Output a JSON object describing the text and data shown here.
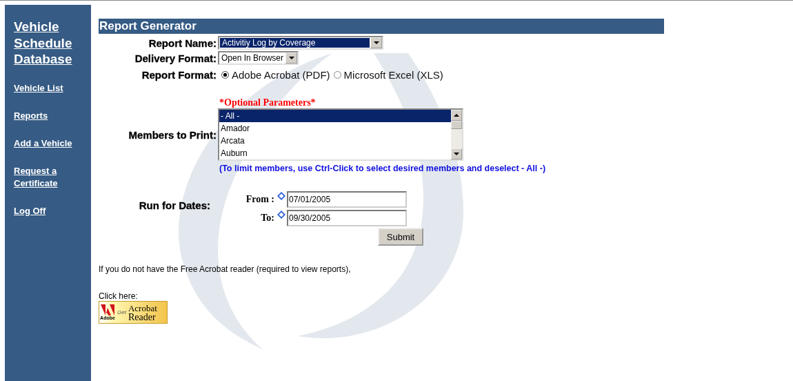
{
  "sidebar": {
    "title": "Vehicle Schedule Database",
    "items": [
      {
        "label": "Vehicle List"
      },
      {
        "label": "Reports"
      },
      {
        "label": "Add a Vehicle"
      },
      {
        "label": "Request a Certificate"
      },
      {
        "label": "Log Off"
      }
    ]
  },
  "header": {
    "title": "Report Generator"
  },
  "report_name": {
    "label": "Report Name:",
    "value": "Activitiy Log by Coverage"
  },
  "delivery_format": {
    "label": "Delivery Format:",
    "value": "Open In Browser"
  },
  "report_format": {
    "label": "Report Format:",
    "options": [
      {
        "label": "Adobe Acrobat (PDF)",
        "selected": true
      },
      {
        "label": "Microsoft Excel (XLS)",
        "selected": false
      }
    ]
  },
  "optional_heading": "*Optional Parameters*",
  "members": {
    "label": "Members to Print:",
    "items": [
      {
        "label": "- All -",
        "selected": true
      },
      {
        "label": "Amador",
        "selected": false
      },
      {
        "label": "Arcata",
        "selected": false
      },
      {
        "label": "Auburn",
        "selected": false
      }
    ],
    "hint": "(To limit members, use Ctrl-Click to select desired members and deselect - All -)"
  },
  "dates": {
    "label": "Run for Dates:",
    "from": {
      "label": "From :",
      "value": "07/01/2005"
    },
    "to": {
      "label": "To:",
      "value": "09/30/2005"
    }
  },
  "submit": "Submit",
  "acrobat_note": "If you do not have the Free Acrobat reader (required to view reports),",
  "click_here": "Click here:",
  "acrobat_badge": {
    "brand": "Adobe",
    "get": "Get",
    "line1": "Acrobat",
    "line2": "Reader"
  }
}
